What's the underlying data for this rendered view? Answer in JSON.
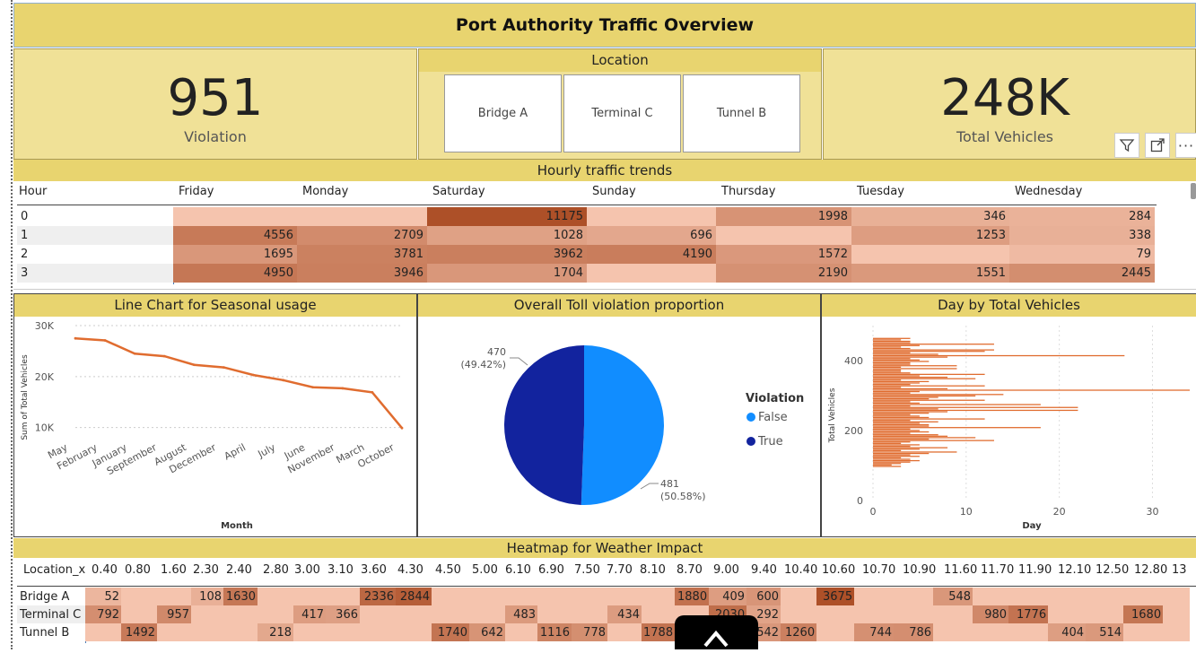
{
  "title": "Port Authority Traffic Overview",
  "kpi_violation": {
    "value": "951",
    "label": "Violation"
  },
  "kpi_vehicles": {
    "value": "248K",
    "label": "Total Vehicles"
  },
  "location": {
    "title": "Location",
    "options": [
      "Bridge A",
      "Terminal C",
      "Tunnel B"
    ]
  },
  "hourly": {
    "title": "Hourly traffic trends",
    "columns": [
      "Hour",
      "Friday",
      "Monday",
      "Saturday",
      "Sunday",
      "Thursday",
      "Tuesday",
      "Wednesday"
    ],
    "rows": [
      {
        "hour": "0",
        "values": [
          "",
          "",
          "11175",
          "",
          "1998",
          "346",
          "284"
        ]
      },
      {
        "hour": "1",
        "values": [
          "4556",
          "2709",
          "1028",
          "696",
          "",
          "1253",
          "338"
        ]
      },
      {
        "hour": "2",
        "values": [
          "1695",
          "3781",
          "3962",
          "4190",
          "1572",
          "",
          "79"
        ]
      },
      {
        "hour": "3",
        "values": [
          "4950",
          "3946",
          "1704",
          "",
          "2190",
          "1551",
          "2445"
        ]
      }
    ]
  },
  "line_chart": {
    "title": "Line Chart for Seasonal usage"
  },
  "pie_chart": {
    "title": "Overall Toll violation proportion"
  },
  "bar_chart": {
    "title": "Day by Total Vehicles"
  },
  "heatmap": {
    "title": "Heatmap for Weather Impact",
    "columns": [
      "Location_x",
      "0.40",
      "0.80",
      "1.60",
      "2.30",
      "2.40",
      "2.80",
      "3.00",
      "3.10",
      "3.60",
      "4.30",
      "4.50",
      "5.00",
      "6.10",
      "6.90",
      "7.50",
      "7.70",
      "8.10",
      "8.70",
      "9.00",
      "9.40",
      "10.40",
      "10.60",
      "10.70",
      "10.90",
      "11.60",
      "11.70",
      "11.90",
      "12.10",
      "12.50",
      "12.80",
      "13"
    ],
    "rows": [
      {
        "name": "Bridge A",
        "values": [
          "52",
          "",
          "",
          "108",
          "1630",
          "",
          "",
          "",
          "2336",
          "2844",
          "",
          "",
          "",
          "",
          "",
          "",
          "",
          "1880",
          "409",
          "600",
          "",
          "3675",
          "",
          "",
          "548",
          "",
          "",
          "",
          "",
          "",
          ""
        ]
      },
      {
        "name": "Terminal C",
        "values": [
          "792",
          "",
          "957",
          "",
          "",
          "",
          "417",
          "366",
          "",
          "",
          "",
          "",
          "483",
          "",
          "",
          "434",
          "",
          "",
          "2030",
          "292",
          "",
          "",
          "",
          "",
          "",
          "980",
          "1776",
          "",
          "",
          "1680",
          ""
        ]
      },
      {
        "name": "Tunnel B",
        "values": [
          "",
          "1492",
          "",
          "",
          "",
          "218",
          "",
          "",
          "",
          "",
          "1740",
          "642",
          "",
          "1116",
          "778",
          "",
          "1788",
          "",
          "",
          "542",
          "1260",
          "",
          "744",
          "786",
          "",
          "",
          "",
          "404",
          "514",
          "",
          ""
        ]
      }
    ]
  },
  "chart_data": [
    {
      "type": "line",
      "title": "Line Chart for Seasonal usage",
      "xlabel": "Month",
      "ylabel": "Sum of Total Vehicles",
      "categories": [
        "May",
        "February",
        "January",
        "September",
        "August",
        "December",
        "April",
        "July",
        "June",
        "November",
        "March",
        "October"
      ],
      "values": [
        27500,
        27100,
        24500,
        24000,
        22300,
        21800,
        20300,
        19300,
        17900,
        17700,
        16900,
        9900
      ],
      "yticks": [
        "10K",
        "20K",
        "30K"
      ],
      "ylim": [
        8000,
        30000
      ],
      "color": "#e06c2f"
    },
    {
      "type": "pie",
      "title": "Overall Toll violation proportion",
      "legend_title": "Violation",
      "slices": [
        {
          "name": "False",
          "value": 481,
          "label": "481",
          "pct": "(50.58%)",
          "color": "#118dff"
        },
        {
          "name": "True",
          "value": 470,
          "label": "470",
          "pct": "(49.42%)",
          "color": "#12239e"
        }
      ],
      "legend": "right"
    },
    {
      "type": "bar",
      "title": "Day by Total Vehicles",
      "xlabel": "Day",
      "ylabel": "Total Vehicles",
      "xticks": [
        "0",
        "10",
        "20",
        "30"
      ],
      "yticks": [
        "0",
        "200",
        "400"
      ],
      "xlim": [
        0,
        34
      ],
      "ylim": [
        0,
        500
      ],
      "color": "#e06c2f",
      "values": [
        4,
        3,
        4,
        4,
        13,
        5,
        3,
        4,
        13,
        12,
        4,
        7,
        27,
        8,
        4,
        5,
        6,
        4,
        4,
        9,
        3,
        9,
        3,
        3,
        4,
        12,
        5,
        8,
        11,
        3,
        6,
        5,
        4,
        12,
        3,
        8,
        34,
        5,
        4,
        14,
        11,
        7,
        6,
        12,
        4,
        5,
        18,
        4,
        22,
        7,
        22,
        8,
        6,
        4,
        5,
        6,
        12,
        4,
        7,
        5,
        6,
        6,
        18,
        4,
        5,
        6,
        4,
        7,
        8,
        11,
        6,
        13,
        4,
        3,
        5,
        4,
        8,
        5,
        3,
        9,
        6,
        4,
        5,
        3,
        4,
        5,
        4,
        3,
        2,
        3
      ]
    }
  ],
  "colors": {
    "header": "#e8d46f",
    "kpi_bg": "#f0e197",
    "heat_low": "#f5c4ae",
    "heat_high": "#ad5028"
  }
}
